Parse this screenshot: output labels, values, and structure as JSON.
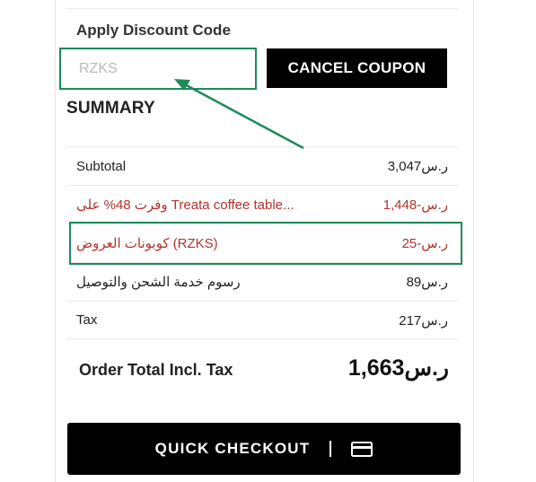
{
  "discount": {
    "title": "Apply Discount Code",
    "code_value": "RZKS",
    "cancel_label": "CANCEL COUPON"
  },
  "summary": {
    "title": "SUMMARY",
    "rows": [
      {
        "label": "Subtotal",
        "value": "ر.س3,047"
      },
      {
        "label": "وفرت 48% على Treata coffee table...",
        "value": "ر.س-1,448"
      },
      {
        "label": "كوبونات العروض (RZKS)",
        "value": "ر.س-25"
      },
      {
        "label": "رسوم خدمة الشحن والتوصيل",
        "value": "ر.س89"
      },
      {
        "label": "Tax",
        "value": "ر.س217"
      }
    ],
    "total_label": "Order Total Incl. Tax",
    "total_value": "ر.س1,663"
  },
  "checkout": {
    "label": "QUICK CHECKOUT",
    "icon": "credit-card-icon"
  },
  "colors": {
    "accent_green": "#1e8a5a",
    "discount_red": "#b3322d",
    "button_black": "#000000"
  }
}
